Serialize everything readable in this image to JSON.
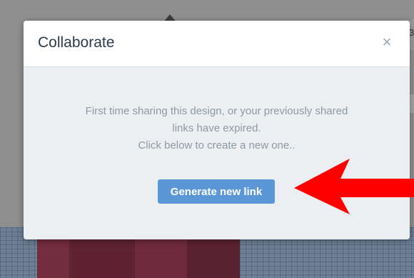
{
  "modal": {
    "title": "Collaborate",
    "close_symbol": "×",
    "message_lines": [
      "First time sharing this design, or your previously shared",
      "links have expired.",
      "Click below to create a new one.."
    ],
    "generate_button_label": "Generate new link"
  },
  "background": {
    "right_chip_text": "3"
  },
  "annotations": {
    "arrow_color": "#ff0000"
  },
  "colors": {
    "accent": "#5b97d6",
    "title": "#2d3b46",
    "message": "#8c9aa5"
  }
}
